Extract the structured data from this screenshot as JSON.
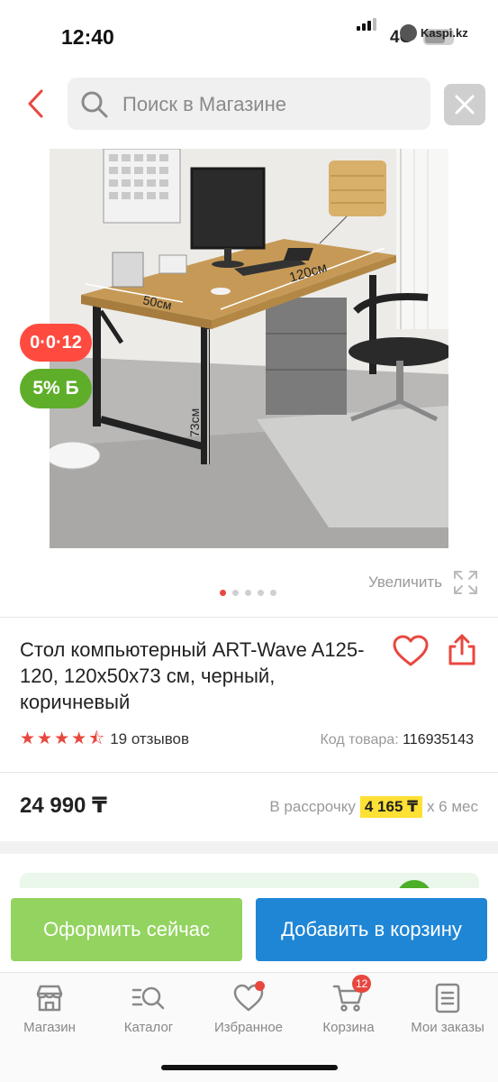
{
  "status_bar": {
    "time": "12:40",
    "network": "4G",
    "carrier": "Kaspi.kz"
  },
  "search": {
    "placeholder": "Поиск в Магазине"
  },
  "product_photo": {
    "labels": {
      "depth": "50см",
      "width": "120см",
      "height": "73см"
    }
  },
  "badges": {
    "installment": "0·0·12",
    "bonus": "5% Б"
  },
  "gallery": {
    "zoom_label": "Увеличить",
    "slide_count": 5,
    "active_slide": 1
  },
  "product": {
    "title": "Стол компьютерный ART-Wave A125-120, 120x50x73 см, черный, коричневый",
    "rating": 4.5,
    "reviews": "19 отзывов",
    "sku_label": "Код товара:",
    "sku_value": "116935143",
    "price": "24 990 ₸",
    "installment_prefix": "В рассрочку",
    "installment_amount": "4 165 ₸",
    "installment_suffix": "x 6 мес"
  },
  "actions": {
    "buy_now": "Оформить сейчас",
    "add_to_cart": "Добавить в корзину"
  },
  "tabbar": {
    "items": [
      {
        "label": "Магазин",
        "icon": "shop-icon"
      },
      {
        "label": "Каталог",
        "icon": "catalog-search-icon"
      },
      {
        "label": "Избранное",
        "icon": "heart-icon"
      },
      {
        "label": "Корзина",
        "icon": "cart-icon",
        "badge": "12"
      },
      {
        "label": "Мои заказы",
        "icon": "orders-icon"
      }
    ]
  },
  "colors": {
    "accent_red": "#e8473f",
    "buy_now_green": "#93d35f",
    "cart_blue": "#1f86d6",
    "installment_yellow": "#ffe034"
  }
}
